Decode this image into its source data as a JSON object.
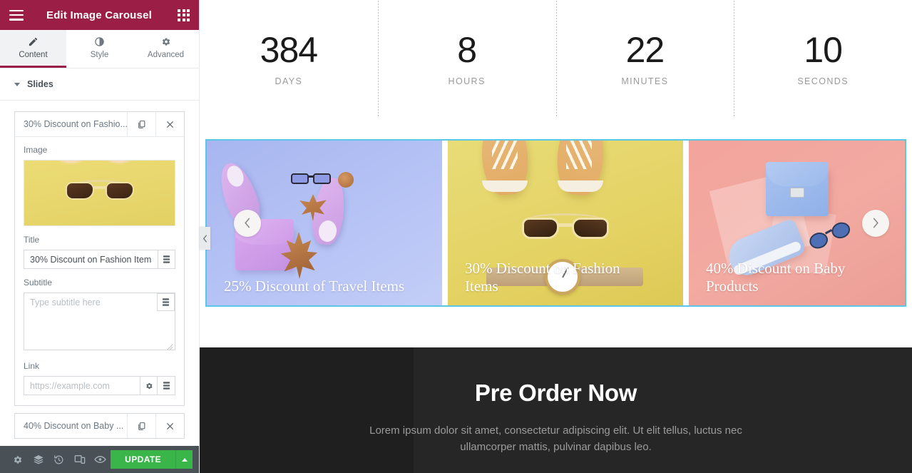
{
  "panel": {
    "header": {
      "title": "Edit Image Carousel",
      "menu_icon": "hamburger-icon",
      "apps_icon": "grid-apps-icon"
    },
    "tabs": [
      {
        "label": "Content",
        "icon": "pencil-icon",
        "active": true
      },
      {
        "label": "Style",
        "icon": "half-circle-icon",
        "active": false
      },
      {
        "label": "Advanced",
        "icon": "gear-icon",
        "active": false
      }
    ],
    "section": {
      "label": "Slides",
      "collapse_icon": "caret-down-icon"
    },
    "slides": [
      {
        "item_title": "30% Discount on Fashio...",
        "expanded": true,
        "duplicate_icon": "duplicate-icon",
        "remove_icon": "close-icon",
        "fields": {
          "image_label": "Image",
          "title_label": "Title",
          "title_value": "30% Discount on Fashion Items",
          "subtitle_label": "Subtitle",
          "subtitle_value": "",
          "subtitle_placeholder": "Type subtitle here",
          "link_label": "Link",
          "link_value": "",
          "link_placeholder": "https://example.com",
          "dynamic_tag_icon": "dynamic-tags-icon",
          "link_options_icon": "gear-icon"
        }
      },
      {
        "item_title": "40% Discount on Baby ...",
        "expanded": false,
        "duplicate_icon": "duplicate-icon",
        "remove_icon": "close-icon"
      }
    ],
    "footer": {
      "icons": [
        "settings-gear-icon",
        "navigator-layers-icon",
        "history-revisions-icon",
        "responsive-mode-icon",
        "preview-eye-icon"
      ],
      "update_label": "UPDATE",
      "update_caret_icon": "caret-up-icon",
      "update_color": "#39b54a"
    },
    "collapse_handle_icon": "chevron-left-icon"
  },
  "preview": {
    "countdown": {
      "items": [
        {
          "value": "384",
          "label": "DAYS"
        },
        {
          "value": "8",
          "label": "HOURS"
        },
        {
          "value": "22",
          "label": "MINUTES"
        },
        {
          "value": "10",
          "label": "SECONDS"
        }
      ]
    },
    "carousel": {
      "selected": true,
      "selection_color": "#59c8e8",
      "prev_icon": "chevron-left-icon",
      "next_icon": "chevron-right-icon",
      "slides": [
        {
          "caption": "25% Discount of Travel Items",
          "bg": "#b3c0f3"
        },
        {
          "caption": "30% Discount on Fashion Items",
          "bg": "#e4d263"
        },
        {
          "caption": "40% Discount on Baby Products",
          "bg": "#f1a49b"
        }
      ]
    },
    "pre_order": {
      "title": "Pre Order Now",
      "text": "Lorem ipsum dolor sit amet, consectetur adipiscing elit. Ut elit tellus, luctus nec ullamcorper mattis, pulvinar dapibus leo."
    }
  }
}
